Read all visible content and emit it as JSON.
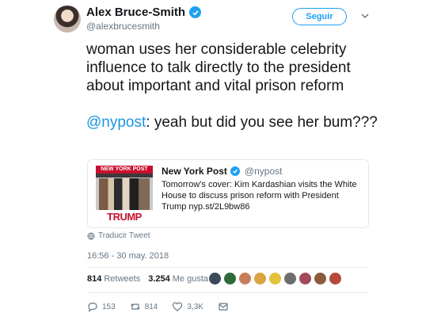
{
  "author": {
    "name": "Alex Bruce-Smith",
    "handle": "@alexbrucesmith"
  },
  "follow_label": "Seguir",
  "tweet": {
    "line1": "woman uses her considerable celebrity influence to talk directly to the president about important and vital prison reform",
    "mention": "@nypost",
    "line2_rest": ": yeah but did you see her bum???"
  },
  "quoted": {
    "name": "New York Post",
    "handle": "@nypost",
    "text": "Tomorrow's cover: Kim Kardashian visits the White House to discuss prison reform with President Trump nyp.st/2L9bw86",
    "cover_masthead": "NEW YORK POST",
    "cover_headline": "TRUMP"
  },
  "translate_label": "Traducir Tweet",
  "timestamp": "16:56 - 30 may. 2018",
  "stats": {
    "retweets_count": "814",
    "retweets_label": "Retweets",
    "likes_count": "3.254",
    "likes_label": "Me gusta"
  },
  "actions": {
    "replies": "153",
    "retweets": "814",
    "likes": "3,3K"
  },
  "colors": {
    "accent": "#1da1f2",
    "mention": "#1b95e0",
    "muted": "#657786"
  },
  "liker_avatars": [
    "#3b4a5a",
    "#2f6b3a",
    "#c87d5a",
    "#d9a441",
    "#e4c23b",
    "#6d6d6d",
    "#a24a5a",
    "#8a5c3c",
    "#b44a3a"
  ]
}
